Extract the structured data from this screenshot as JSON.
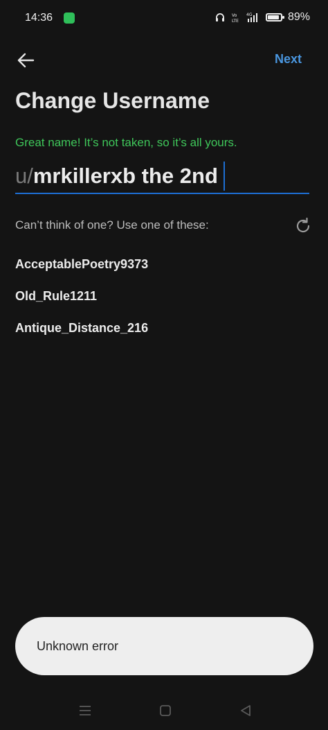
{
  "status_bar": {
    "time": "14:36",
    "network_label": "4G",
    "battery_percent": 89,
    "battery_label": "89%"
  },
  "header": {
    "next_label": "Next",
    "title": "Change Username"
  },
  "username": {
    "status_message": "Great name! It’s not taken, so it’s all yours.",
    "prefix": "u/",
    "value": "mrkillerxb the 2nd"
  },
  "suggestions": {
    "prompt": "Can’t think of one? Use one of these:",
    "items": [
      {
        "label": "AcceptablePoetry9373"
      },
      {
        "label": "Old_Rule1211"
      },
      {
        "label": "Antique_Distance_216"
      }
    ]
  },
  "toast": {
    "message": "Unknown error"
  },
  "colors": {
    "background": "#141414",
    "accent": "#4a97e0",
    "success": "#3fc75a"
  }
}
